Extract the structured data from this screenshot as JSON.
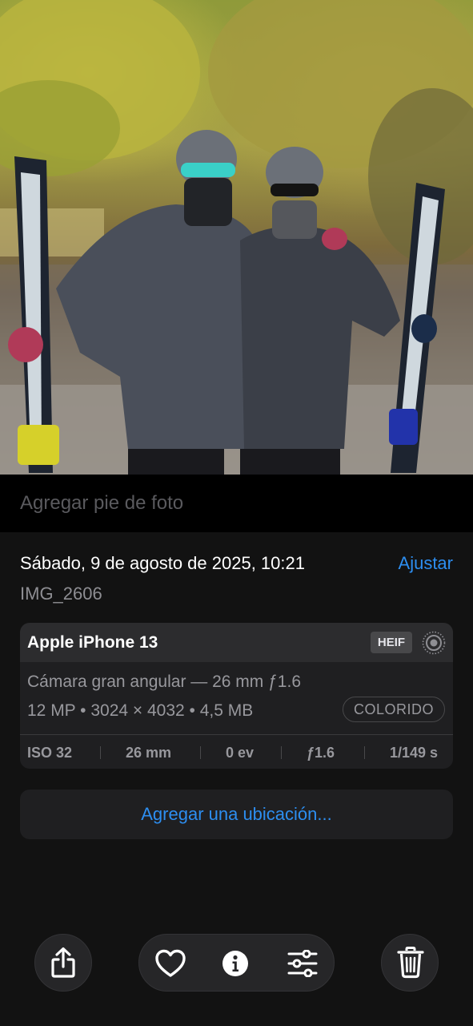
{
  "caption": {
    "placeholder": "Agregar pie de foto"
  },
  "info": {
    "date": "Sábado, 9 de agosto de 2025, 10:21",
    "adjust_label": "Ajustar",
    "filename": "IMG_2606"
  },
  "camera": {
    "device": "Apple iPhone 13",
    "format": "HEIF",
    "lens": "Cámara gran angular — 26 mm ƒ1.6",
    "specs": "12 MP • 3024 × 4032 • 4,5 MB",
    "style": "COLORIDO",
    "exif": {
      "iso": "ISO 32",
      "focal": "26 mm",
      "ev": "0 ev",
      "aperture": "ƒ1.6",
      "shutter": "1/149 s"
    }
  },
  "location": {
    "label": "Agregar una ubicación..."
  },
  "toolbar": {
    "share_icon": "share-icon",
    "favorite_icon": "heart-icon",
    "info_icon": "info-icon",
    "adjust_icon": "sliders-icon",
    "delete_icon": "trash-icon"
  }
}
